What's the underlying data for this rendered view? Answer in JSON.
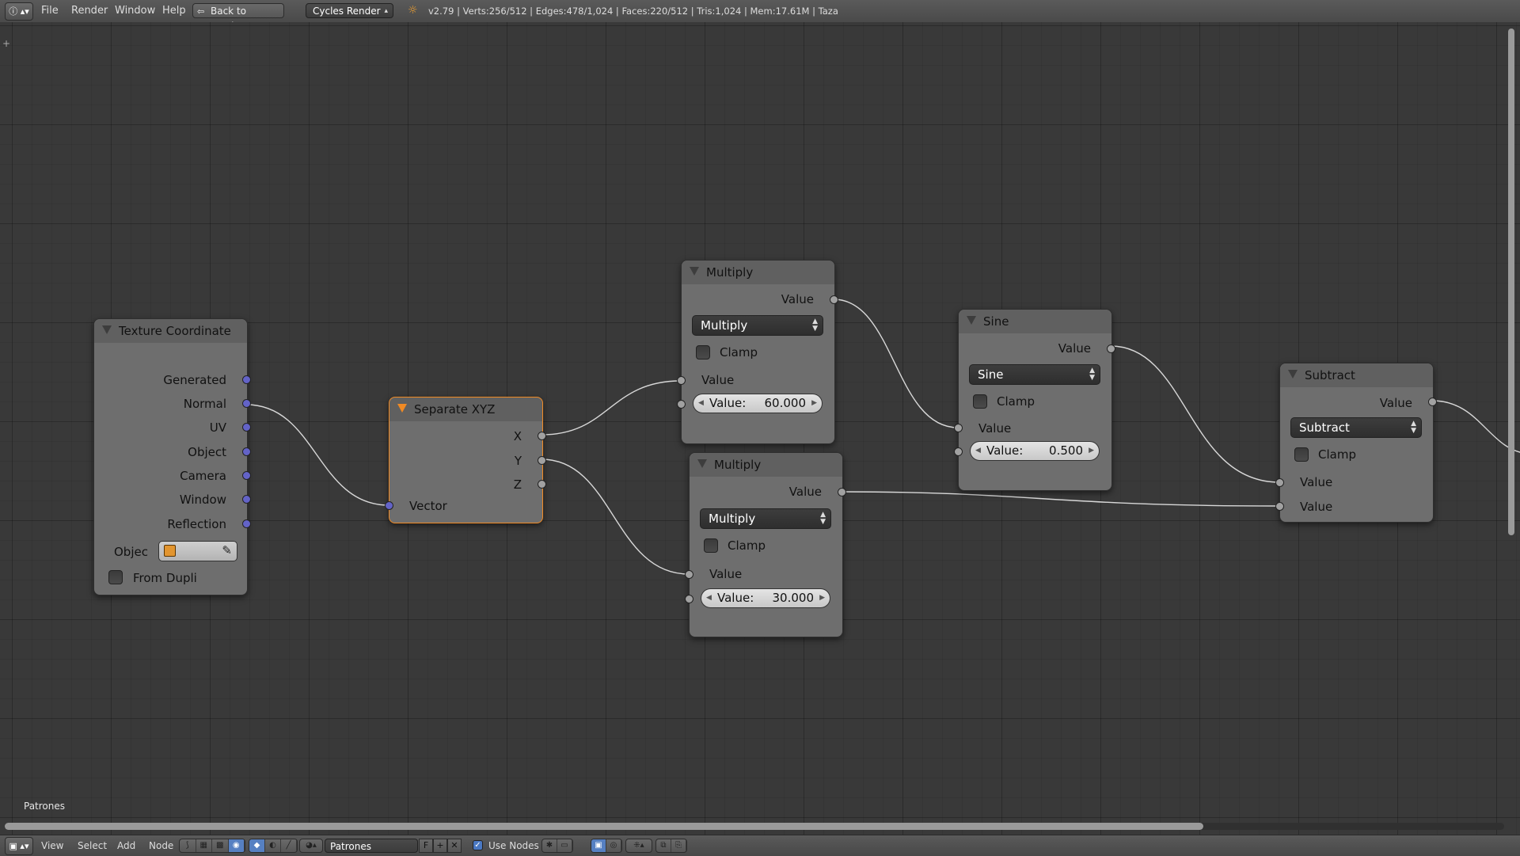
{
  "top_bar": {
    "menus": [
      "File",
      "Render",
      "Window",
      "Help"
    ],
    "back_button": "Back to Previous",
    "render_engine": "Cycles Render",
    "stats": "v2.79 | Verts:256/512 | Edges:478/1,024 | Faces:220/512 | Tris:1,024 | Mem:17.61M | Taza"
  },
  "nodes": {
    "texture_coordinate": {
      "title": "Texture Coordinate",
      "outputs": [
        "Generated",
        "Normal",
        "UV",
        "Object",
        "Camera",
        "Window",
        "Reflection"
      ],
      "object_label": "Objec",
      "from_dupli_label": "From Dupli"
    },
    "separate_xyz": {
      "title": "Separate XYZ",
      "outputs": [
        "X",
        "Y",
        "Z"
      ],
      "input": "Vector"
    },
    "multiply_1": {
      "title": "Multiply",
      "output": "Value",
      "operation": "Multiply",
      "clamp_label": "Clamp",
      "input_label": "Value",
      "field_label": "Value:",
      "field_value": "60.000"
    },
    "multiply_2": {
      "title": "Multiply",
      "output": "Value",
      "operation": "Multiply",
      "clamp_label": "Clamp",
      "input_label": "Value",
      "field_label": "Value:",
      "field_value": "30.000"
    },
    "sine": {
      "title": "Sine",
      "output": "Value",
      "operation": "Sine",
      "clamp_label": "Clamp",
      "input_label": "Value",
      "field_label": "Value:",
      "field_value": "0.500"
    },
    "subtract": {
      "title": "Subtract",
      "output": "Value",
      "operation": "Subtract",
      "clamp_label": "Clamp",
      "input_1": "Value",
      "input_2": "Value"
    }
  },
  "canvas": {
    "node_tree_name": "Patrones"
  },
  "bottom_bar": {
    "menus": [
      "View",
      "Select",
      "Add",
      "Node"
    ],
    "node_tree": "Patrones",
    "fake_user": "F",
    "use_nodes_label": "Use Nodes",
    "use_nodes": true
  },
  "colors": {
    "vector_socket": "#6363c7",
    "value_socket": "#a1a1a1",
    "selected_outline": "#f08a24",
    "node_body": "#6e6e6e",
    "node_header": "#606060"
  },
  "icons": [
    "info-icon",
    "back-icon",
    "blender-logo-icon",
    "object-cube-icon",
    "eyedropper-icon"
  ]
}
